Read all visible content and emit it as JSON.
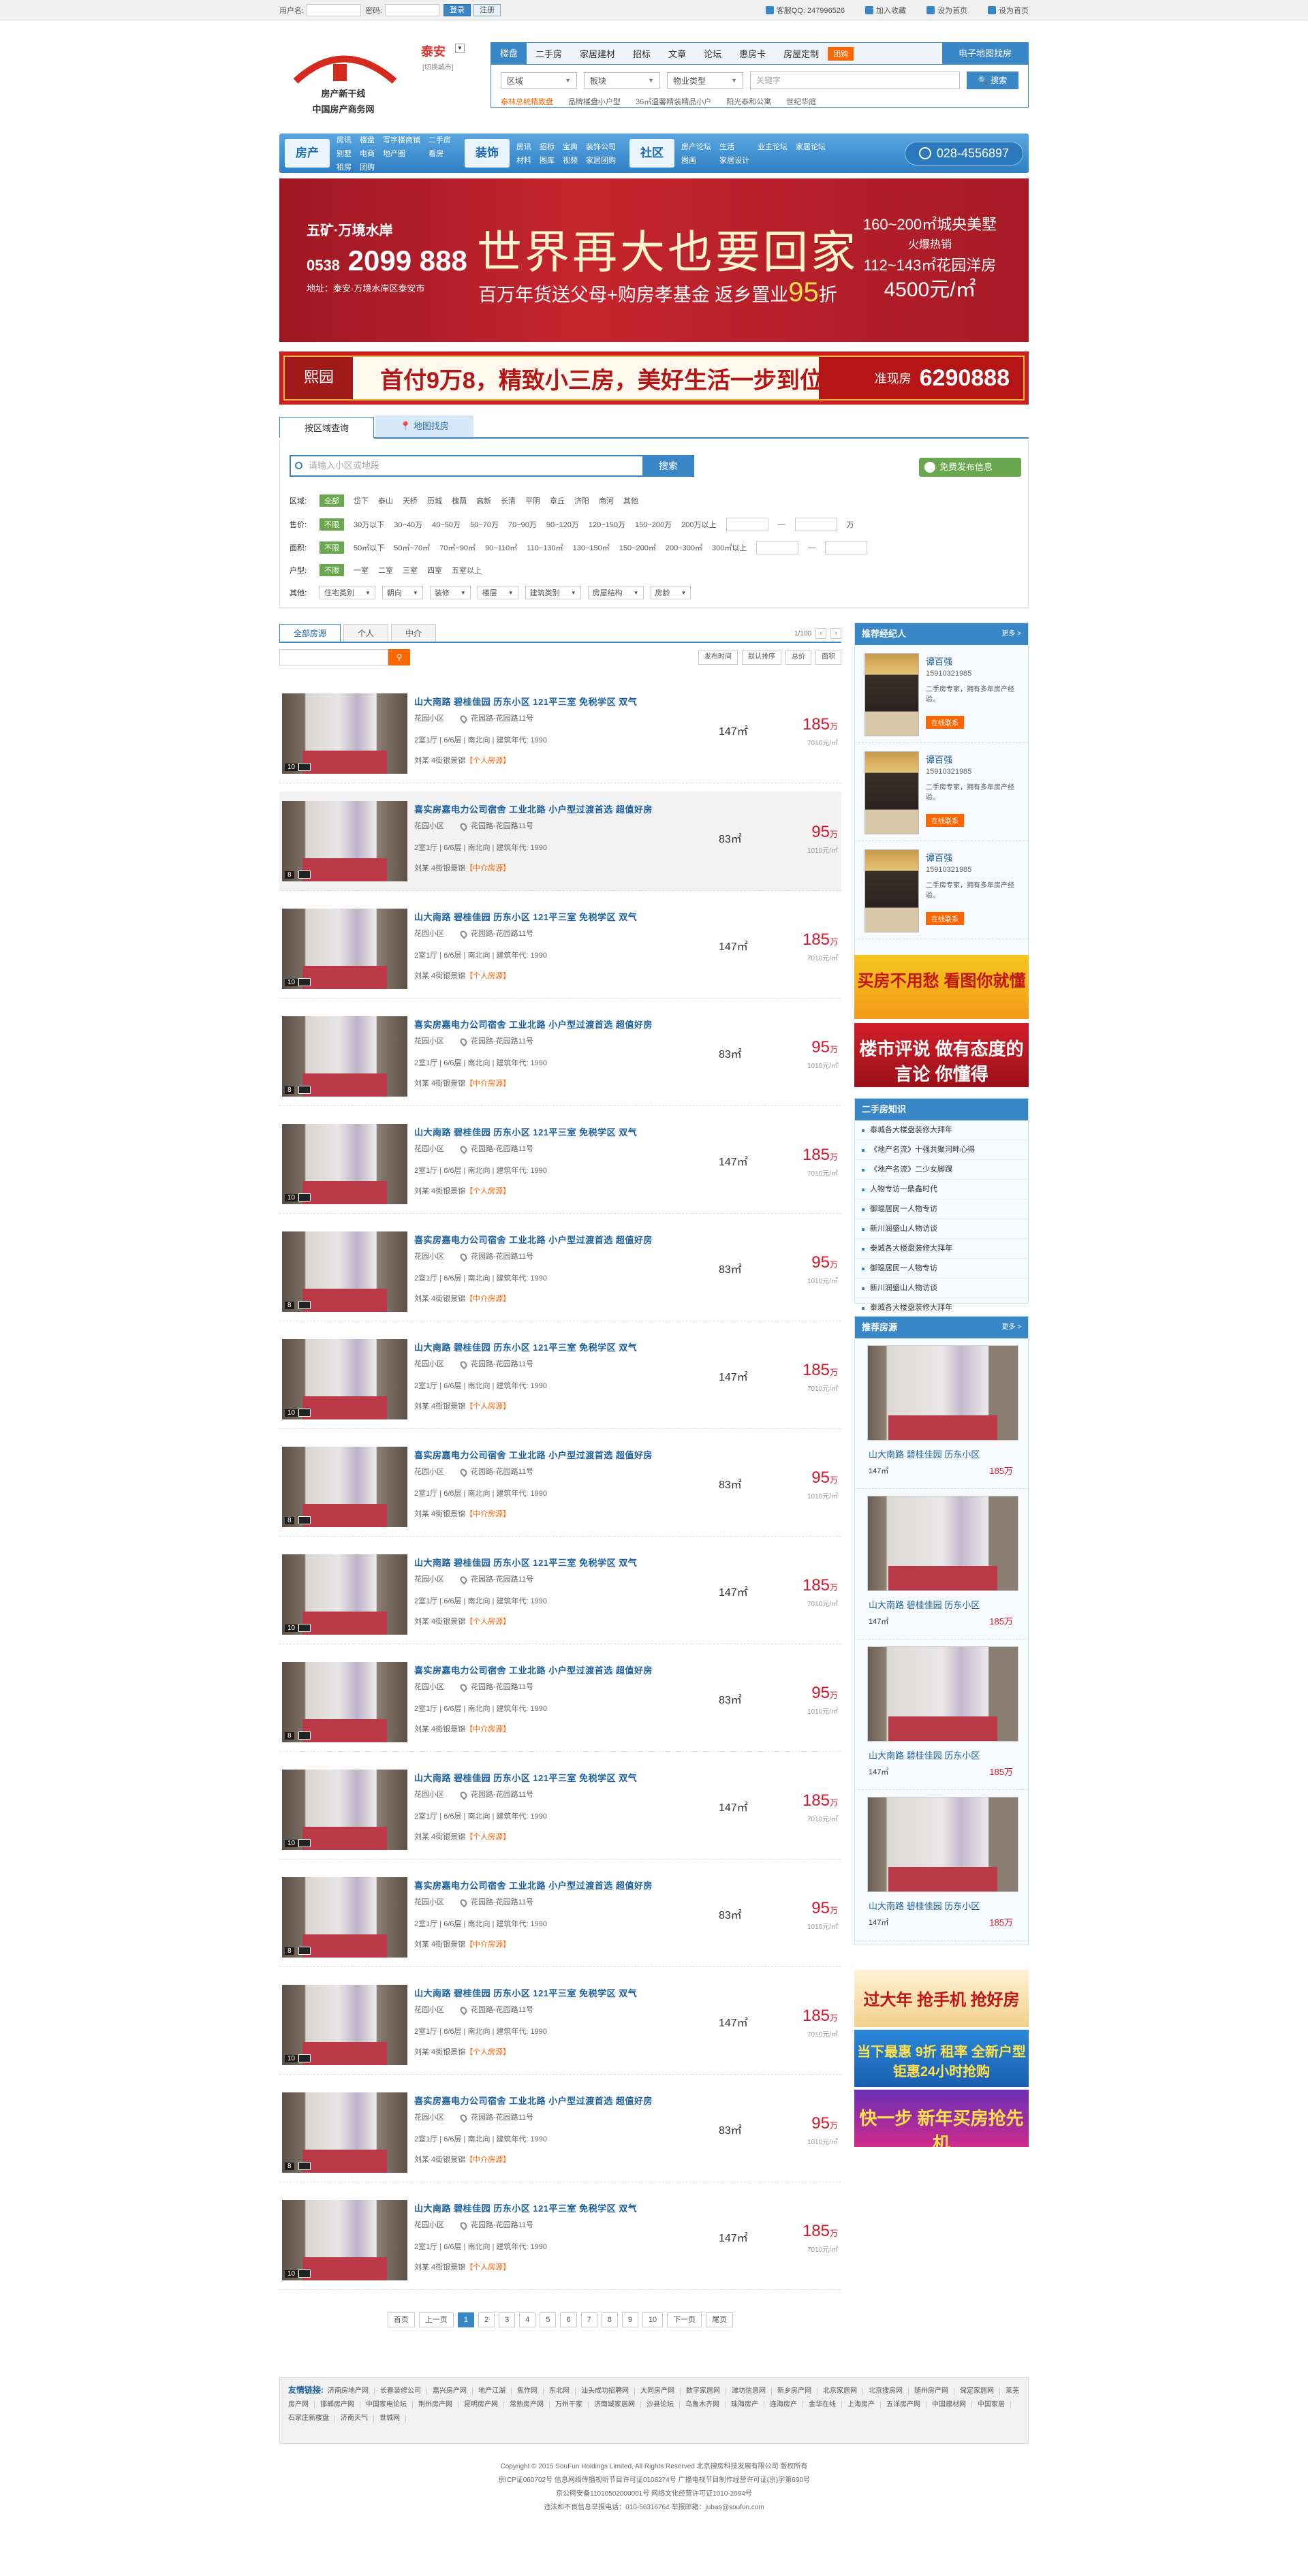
{
  "topbar": {
    "user_label": "用户名:",
    "pwd_label": "密码:",
    "login": "登录",
    "register": "注册",
    "service": "客服QQ: 247996526",
    "fav": "加入收藏",
    "home": "设为首页",
    "newwin": "设为首页"
  },
  "header": {
    "logo_line1": "房产新干线",
    "logo_line2": "中国房产商务网",
    "city": "泰安",
    "city_sub": "[切换城市]",
    "tabs": [
      "楼盘",
      "二手房",
      "家居建材",
      "招标",
      "文章",
      "论坛",
      "惠房卡",
      "房屋定制"
    ],
    "hot": "团购",
    "map": "电子地图找房",
    "sel1": "区域",
    "sel2": "板块",
    "sel3": "物业类型",
    "kw_placeholder": "关键字",
    "search": "搜索",
    "hotlinks": [
      "泰林总统精致盘",
      "品牌楼盘小户型",
      "36㎡温馨精装精品小户",
      "阳光泰和公寓",
      "世纪华庭"
    ]
  },
  "nav": {
    "blocks": [
      {
        "title": "房产",
        "links": [
          "房讯",
          "楼盘",
          "写字楼商铺",
          "二手房",
          "别墅",
          "电商",
          "地产圈",
          "看房",
          "租房",
          "团购"
        ]
      },
      {
        "title": "装饰",
        "links": [
          "房讯",
          "招标",
          "宝典",
          "装饰公司",
          "材料",
          "图库",
          "视频",
          "家居团购"
        ]
      },
      {
        "title": "社区",
        "links": [
          "房产论坛",
          "生活",
          "业主论坛",
          "家居论坛",
          "图画",
          "家居设计"
        ]
      }
    ],
    "phone": "028-4556897"
  },
  "banner1": {
    "brand": "五矿·万境水岸",
    "tel_pre": "0538",
    "tel": "2099 888",
    "addr": "地址：泰安·万境水岸区泰安市",
    "main": "世界再大也要回家",
    "sub_a": "百万年货送父母+购房孝基金  返乡置业",
    "sub_n": "95",
    "sub_b": "折",
    "r1": "160~200㎡城央美墅",
    "r2": "火爆热销",
    "r3": "112~143㎡花园洋房",
    "r4": "4500元/㎡"
  },
  "banner2": {
    "logo": "熙园",
    "slogan": "首付9万8，精致小三房，美好生活一步到位！",
    "tag": "准现房",
    "tel": "6290888"
  },
  "filter": {
    "tabs": [
      "按区域查询",
      "地图找房"
    ],
    "placeholder": "请输入小区或地段",
    "search": "搜索",
    "publish": "免费发布信息",
    "rows": [
      {
        "label": "区域:",
        "all": "全部",
        "opts": [
          "岱下",
          "泰山",
          "天桥",
          "历城",
          "槐荫",
          "高新",
          "长清",
          "平阴",
          "章丘",
          "济阳",
          "商河",
          "其他"
        ]
      },
      {
        "label": "售价:",
        "all": "不限",
        "opts": [
          "30万以下",
          "30~40万",
          "40~50万",
          "50~70万",
          "70~90万",
          "90~120万",
          "120~150万",
          "150~200万",
          "200万以上"
        ],
        "unit": "万"
      },
      {
        "label": "面积:",
        "all": "不限",
        "opts": [
          "50㎡以下",
          "50㎡~70㎡",
          "70㎡~90㎡",
          "90~110㎡",
          "110~130㎡",
          "130~150㎡",
          "150~200㎡",
          "200~300㎡",
          "300㎡以上"
        ]
      },
      {
        "label": "户型:",
        "all": "不限",
        "opts": [
          "一室",
          "二室",
          "三室",
          "四室",
          "五室以上"
        ]
      }
    ],
    "other_label": "其他:",
    "selects": [
      "住宅类别",
      "朝向",
      "装修",
      "楼层",
      "建筑类别",
      "房屋结构",
      "房龄"
    ]
  },
  "list": {
    "tabs": [
      "全部房源",
      "个人",
      "中介"
    ],
    "page": "1/100",
    "sorts": [
      "发布时间",
      "默认排序",
      "总价",
      "面积"
    ]
  },
  "listings": [
    {
      "title": "山大南路  碧桂佳园  历东小区  121平三室  免税学区  双气",
      "comm": "花园小区",
      "addr": "花园路-花园路11号",
      "info": "2室1厅 | 6/6层 | 南北向 | 建筑年代: 1990",
      "agent": "刘某  4街银景锦",
      "tag": "【个人房源】",
      "area": "147㎡",
      "price": "185",
      "unit": "万",
      "uprice": "7010元/㎡",
      "cnt": "10"
    },
    {
      "title": "喜实房嘉电力公司宿舍  工业北路  小户型过渡首选  超值好房",
      "comm": "花园小区",
      "addr": "花园路-花园路11号",
      "info": "2室1厅 | 6/6层 | 南北向 | 建筑年代: 1990",
      "agent": "刘某  4街银景锦",
      "tag": "【中介房源】",
      "area": "83㎡",
      "price": "95",
      "unit": "万",
      "uprice": "1010元/㎡",
      "cnt": "8"
    }
  ],
  "pager": [
    "首页",
    "上一页",
    "1",
    "2",
    "3",
    "4",
    "5",
    "6",
    "7",
    "8",
    "9",
    "10",
    "下一页",
    "尾页"
  ],
  "side": {
    "agents_title": "推荐经纪人",
    "more": "更多 >",
    "agents": [
      {
        "name": "谭百强",
        "tel": "15910321985",
        "desc": "二手房专家，拥有多年房产经验。",
        "btn": "在线联系"
      },
      {
        "name": "谭百强",
        "tel": "15910321985",
        "desc": "二手房专家，拥有多年房产经验。",
        "btn": "在线联系"
      },
      {
        "name": "谭百强",
        "tel": "15910321985",
        "desc": "二手房专家，拥有多年房产经验。",
        "btn": "在线联系"
      }
    ],
    "ad1": "买房不用愁 看图你就懂",
    "ad2": "楼市评说 做有态度的言论 你懂得",
    "know_title": "二手房知识",
    "know": [
      "泰城各大楼盘装修大拜年",
      "《地产名流》十强共聚河畔心得",
      "《地产名流》二少女脚踝",
      "人物专访一鼎鑫时代",
      "御琨居民一人物专访",
      "新川润盛山人物访谈",
      "泰城各大楼盘装修大拜年",
      "御琨居民一人物专访",
      "新川润盛山人物访谈",
      "泰城各大楼盘装修大拜年"
    ],
    "rec_title": "推荐房源",
    "rec": {
      "title": "山大南路  碧桂佳园  历东小区",
      "area": "147㎡",
      "price": "185万"
    },
    "ad3": "过大年 抢手机 抢好房",
    "ad4": "当下最惠 9折 租率 全新户型钜惠24小时抢购",
    "ad5": "快一步 新年买房抢先机"
  },
  "friends": {
    "label": "友情链接:",
    "links": [
      "济南房地产网",
      "长春装修公司",
      "嘉兴房产网",
      "地产江湖",
      "焦作网",
      "东北网",
      "汕头成功招聘网",
      "大同房产网",
      "数字家居网",
      "潍坊信息网",
      "新乡房产网",
      "北京家居网",
      "北京搜房网",
      "随州房产网",
      "保定家居网",
      "莱芜房产网",
      "邯郸房产网",
      "中国家电论坛",
      "荆州房产网",
      "昆明房产网",
      "常熟房产网",
      "万州干家",
      "济南城家居网",
      "沙县论坛",
      "乌鲁木齐网",
      "珠海房产",
      "连海房产",
      "金华在线",
      "上海房产",
      "五洋房产网",
      "中国建材网",
      "中国家居",
      "石家庄新楼盘",
      "济南天气",
      "世城网"
    ]
  },
  "footer": {
    "lines": [
      "Copyright © 2015 SouFun Holdings Limited, All Rights Reserved 北京搜房科技发展有限公司 版权所有",
      "京ICP证060702号 信息网络传播视听节目许可证0108274号 广播电视节目制作经营许可证(京)字第690号",
      "京公网安备11010502000001号 网络文化经营许可证1010-2094号",
      "违法和不良信息举报电话：010-56316764 举报邮箱：jubao@soufun.com"
    ]
  }
}
